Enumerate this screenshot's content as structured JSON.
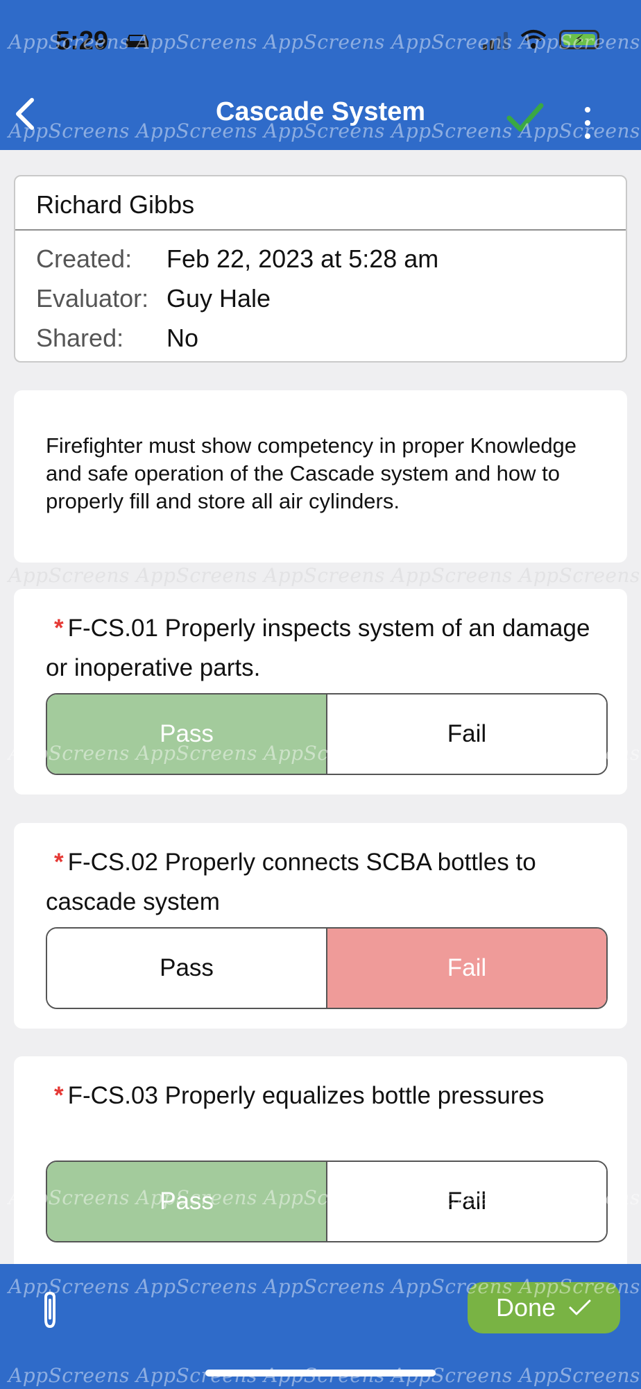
{
  "status_bar": {
    "time": "5:29"
  },
  "header": {
    "title": "Cascade System"
  },
  "record": {
    "name": "Richard Gibbs",
    "created_label": "Created:",
    "created_value": "Feb 22, 2023 at 5:28 am",
    "evaluator_label": "Evaluator:",
    "evaluator_value": "Guy Hale",
    "shared_label": "Shared:",
    "shared_value": "No"
  },
  "description": "Firefighter must show competency in proper Knowledge and safe operation of the Cascade system and how to properly fill and store all air cylinders.",
  "required_marker": "*",
  "questions": [
    {
      "title": "F-CS.01 Properly inspects system of an damage or inoperative parts.",
      "pass_label": "Pass",
      "fail_label": "Fail",
      "selected": "pass"
    },
    {
      "title": "F-CS.02 Properly connects SCBA bottles to cascade system",
      "pass_label": "Pass",
      "fail_label": "Fail",
      "selected": "fail"
    },
    {
      "title": "F-CS.03 Properly equalizes bottle pressures",
      "pass_label": "Pass",
      "fail_label": "Fail",
      "selected": "pass"
    }
  ],
  "footer": {
    "done_label": "Done"
  },
  "watermark": "AppScreens",
  "colors": {
    "brand_blue": "#2f6bc9",
    "pass_selected": "#a3cb9c",
    "fail_selected": "#ef9b99",
    "done_green": "#79b344",
    "required_red": "#e53935"
  }
}
